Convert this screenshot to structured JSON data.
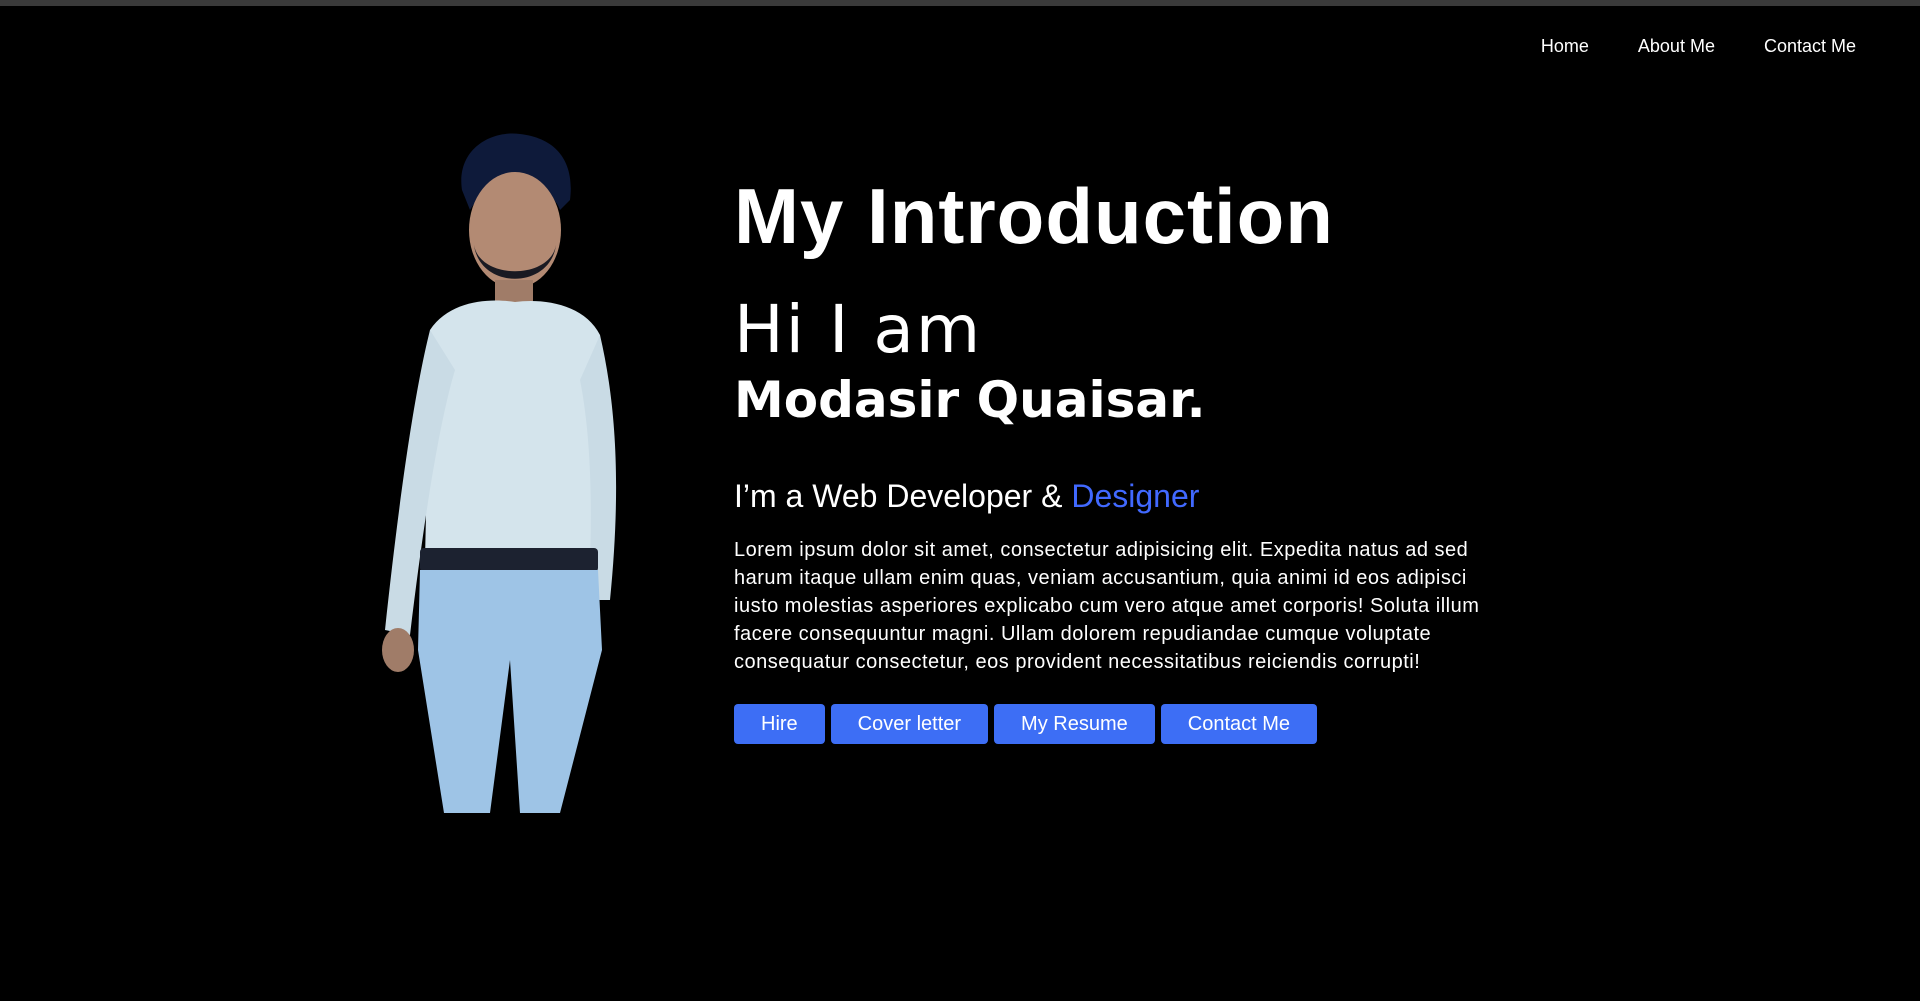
{
  "nav": {
    "items": [
      {
        "label": "Home"
      },
      {
        "label": "About Me"
      },
      {
        "label": "Contact Me"
      }
    ]
  },
  "hero": {
    "title": "My Introduction",
    "greeting": "Hi I am",
    "name": "Modasir Quaisar.",
    "role_prefix": "I’m a Web Developer & ",
    "role_accent": "Designer",
    "description": "Lorem ipsum dolor sit amet, consectetur adipisicing elit. Expedita natus ad sed harum itaque ullam enim quas, veniam accusantium, quia animi id eos adipisci iusto molestias asperiores explicabo cum vero atque amet corporis! Soluta illum facere consequuntur magni. Ullam dolorem repudiandae cumque voluptate consequatur consectetur, eos provident necessitatibus reiciendis corrupti!",
    "buttons": [
      {
        "label": "Hire"
      },
      {
        "label": "Cover letter"
      },
      {
        "label": "My Resume"
      },
      {
        "label": "Contact Me"
      }
    ]
  },
  "colors": {
    "background": "#000000",
    "accent": "#4169ff",
    "button": "#3d6ef5",
    "text": "#ffffff"
  }
}
